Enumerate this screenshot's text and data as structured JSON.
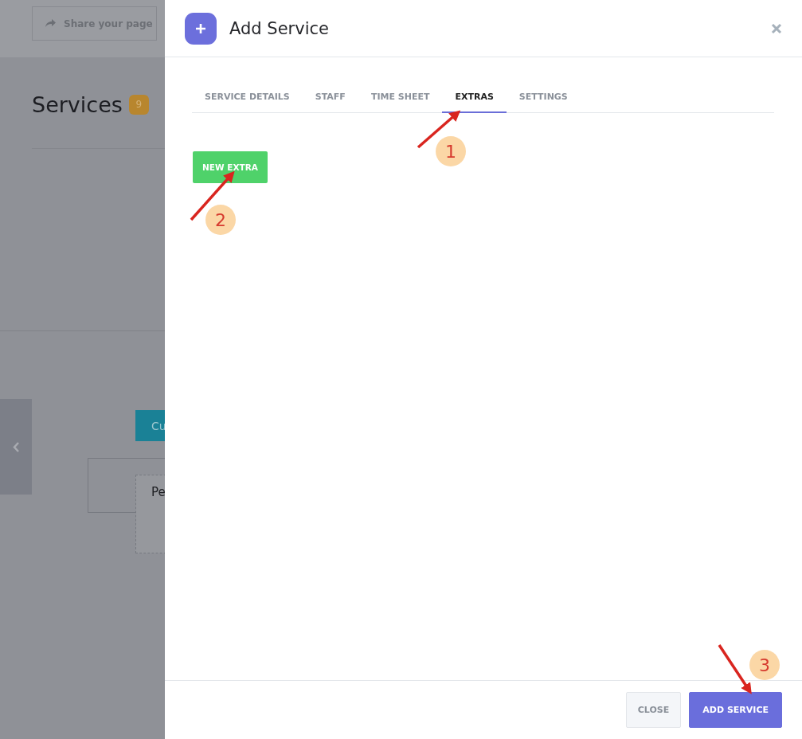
{
  "background_page": {
    "share_button": "Share your page",
    "heading": "Services",
    "count_badge": "9",
    "nav_button": "Cu",
    "card_label": "Pe"
  },
  "modal": {
    "title": "Add Service",
    "tabs": [
      {
        "label": "SERVICE DETAILS",
        "selected": false
      },
      {
        "label": "STAFF",
        "selected": false
      },
      {
        "label": "TIME SHEET",
        "selected": false
      },
      {
        "label": "EXTRAS",
        "selected": true
      },
      {
        "label": "SETTINGS",
        "selected": false
      }
    ],
    "new_extra_button": "NEW EXTRA",
    "footer_buttons": [
      {
        "label": "CLOSE",
        "kind": "secondary"
      },
      {
        "label": "ADD SERVICE",
        "kind": "primary"
      }
    ]
  },
  "annotations": [
    {
      "number": "1"
    },
    {
      "number": "2"
    },
    {
      "number": "3"
    }
  ]
}
